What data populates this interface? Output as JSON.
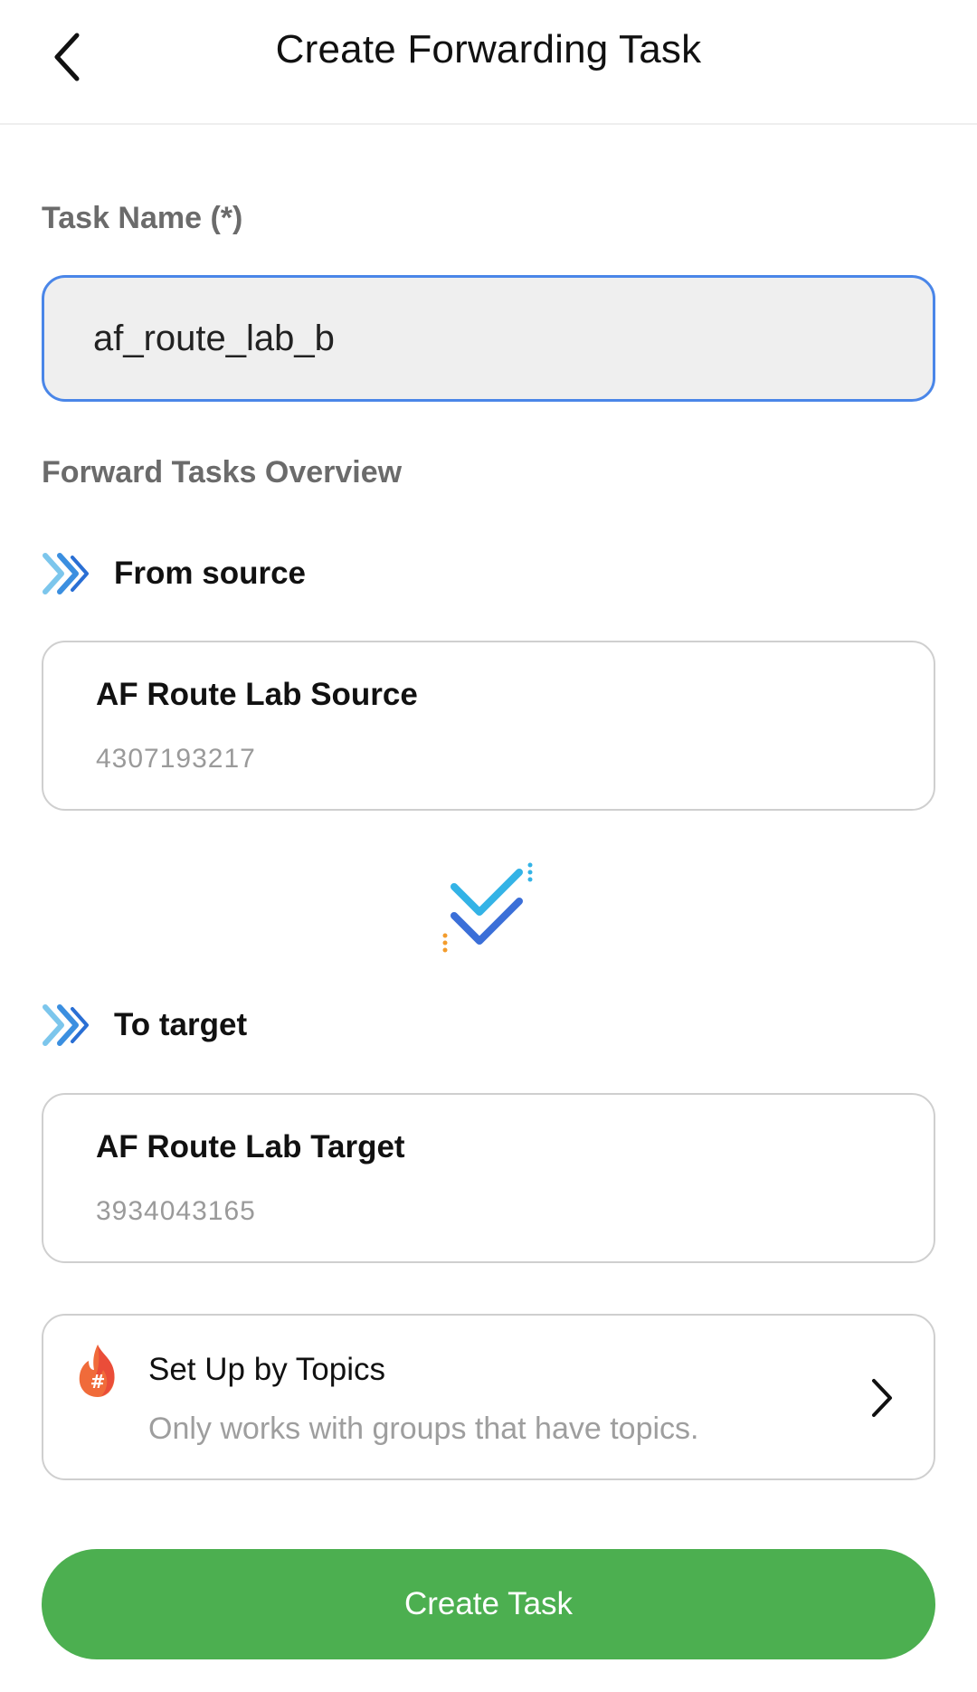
{
  "header": {
    "title": "Create Forwarding Task",
    "back_icon": "chevron-left-icon"
  },
  "form": {
    "task_name_label": "Task Name (*)",
    "task_name_value": "af_route_lab_b",
    "overview_label": "Forward Tasks Overview"
  },
  "source": {
    "section_label": "From source",
    "name": "AF Route Lab Source",
    "id": "4307193217"
  },
  "target": {
    "section_label": "To target",
    "name": "AF Route Lab Target",
    "id": "3934043165"
  },
  "topics": {
    "title": "Set Up by Topics",
    "subtitle": "Only works with groups that have topics."
  },
  "actions": {
    "create_label": "Create Task"
  },
  "colors": {
    "accent_green": "#4caf50",
    "input_border_blue": "#4a86e8",
    "icon_blue": "#3b8fe0",
    "icon_cyan": "#33b3e6"
  }
}
